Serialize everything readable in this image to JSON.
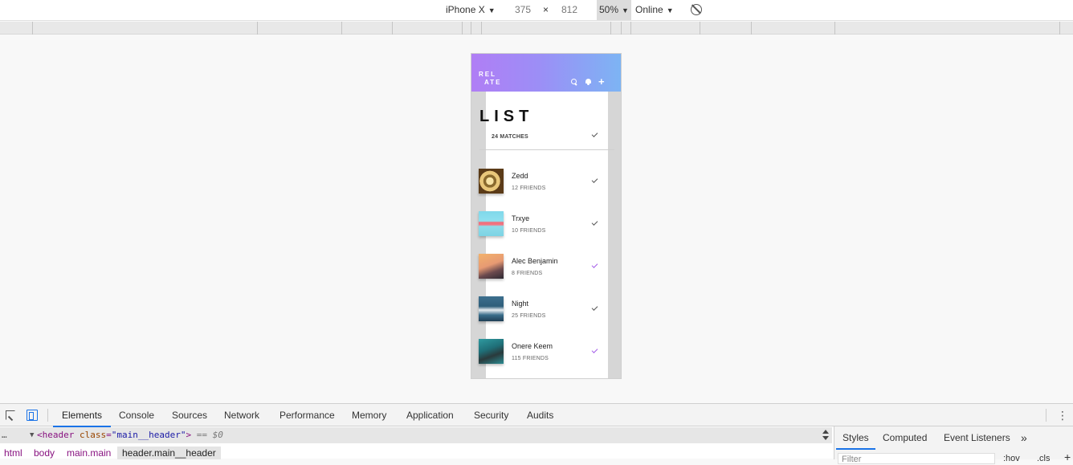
{
  "device_toolbar": {
    "device": "iPhone X",
    "width": "375",
    "times": "×",
    "height": "812",
    "zoom": "50%",
    "network": "Online"
  },
  "app": {
    "logo_line1": "REL",
    "logo_line2": "ATE",
    "title": "LIST",
    "matches": "24 MATCHES",
    "accent_color": "#a45ee8",
    "gradient_start": "#b07ef5",
    "gradient_end": "#7db4f4",
    "items": [
      {
        "name": "Zedd",
        "sub": "12 FRIENDS",
        "checked_accent": false
      },
      {
        "name": "Trxye",
        "sub": "10 FRIENDS",
        "checked_accent": false
      },
      {
        "name": "Alec Benjamin",
        "sub": "8 FRIENDS",
        "checked_accent": true
      },
      {
        "name": "Night",
        "sub": "25 FRIENDS",
        "checked_accent": false
      },
      {
        "name": "Onere Keem",
        "sub": "115 FRIENDS",
        "checked_accent": true
      }
    ]
  },
  "devtools": {
    "tabs": [
      "Elements",
      "Console",
      "Sources",
      "Network",
      "Performance",
      "Memory",
      "Application",
      "Security",
      "Audits"
    ],
    "active_tab": "Elements",
    "dom": {
      "prefix": "…",
      "open": "▼",
      "tag": "header",
      "attr": "class",
      "value": "\"main__header\"",
      "suffix": "== $0"
    },
    "breadcrumbs": [
      "html",
      "body",
      "main.main",
      "header.main__header"
    ],
    "styles_tabs": [
      "Styles",
      "Computed",
      "Event Listeners"
    ],
    "filter_placeholder": "Filter",
    "hov": ":hov",
    "cls": ".cls",
    "plus": "+"
  }
}
